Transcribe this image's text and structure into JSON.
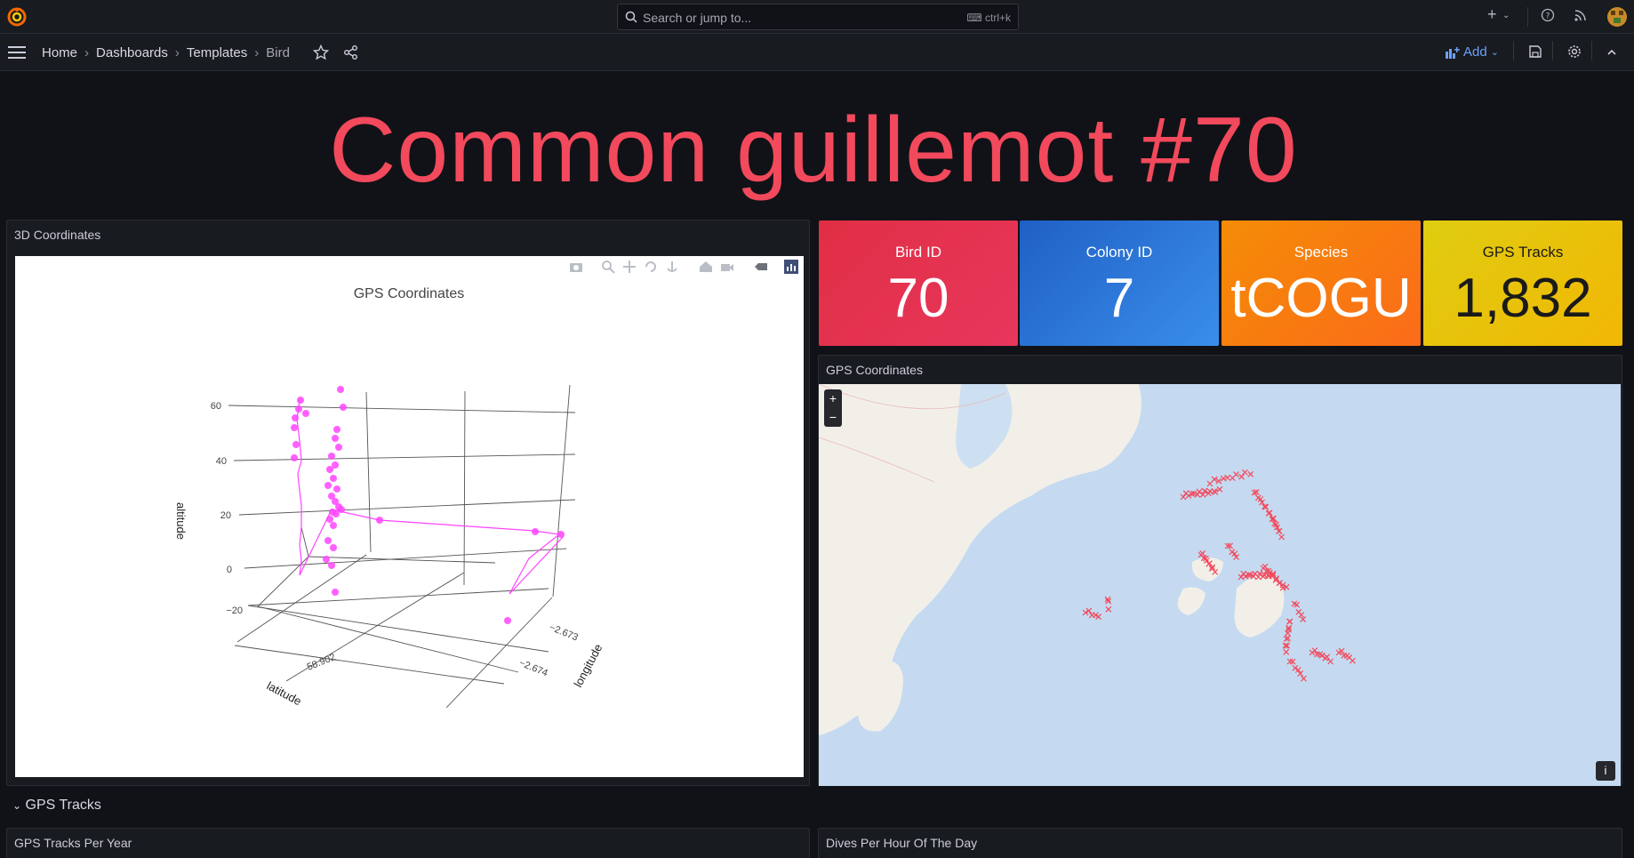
{
  "topbar": {
    "search_placeholder": "Search or jump to...",
    "search_shortcut": "ctrl+k",
    "icons": [
      "grafana-logo-icon",
      "plus-icon",
      "chevron-down-icon",
      "help-icon",
      "rss-icon",
      "avatar"
    ]
  },
  "breadcrumb": {
    "items": [
      "Home",
      "Dashboards",
      "Templates",
      "Bird"
    ],
    "separator": "›"
  },
  "toolbar": {
    "add_label": "Add"
  },
  "dashboard": {
    "title": "Common guillemot #70"
  },
  "panels": {
    "coords3d": {
      "title": "3D Coordinates",
      "plot": {
        "title": "GPS Coordinates",
        "axes": {
          "altitude": {
            "label": "altitude",
            "ticks": [
              "60",
              "40",
              "20",
              "0",
              "−20"
            ]
          },
          "latitude": {
            "label": "latitude",
            "ticks": [
              "58.902"
            ]
          },
          "longitude": {
            "label": "longitude",
            "ticks": [
              "−2.673",
              "−2.674"
            ]
          }
        },
        "marker_color": "#ff44ff"
      }
    },
    "stats": [
      {
        "label": "Bird ID",
        "value": "70",
        "color": "#e02f44"
      },
      {
        "label": "Colony ID",
        "value": "7",
        "color": "#1f60c4"
      },
      {
        "label": "Species",
        "value": "tCOGU",
        "color": "#ff780a"
      },
      {
        "label": "GPS Tracks",
        "value": "1,832",
        "color": "#e0b400"
      }
    ],
    "map": {
      "title": "GPS Coordinates",
      "zoom_in": "+",
      "zoom_out": "−",
      "info": "i",
      "marker_color": "#f2495c"
    },
    "row_title": "GPS Tracks",
    "bottom_left_title": "GPS Tracks Per Year",
    "bottom_right_title": "Dives Per Hour Of The Day"
  }
}
